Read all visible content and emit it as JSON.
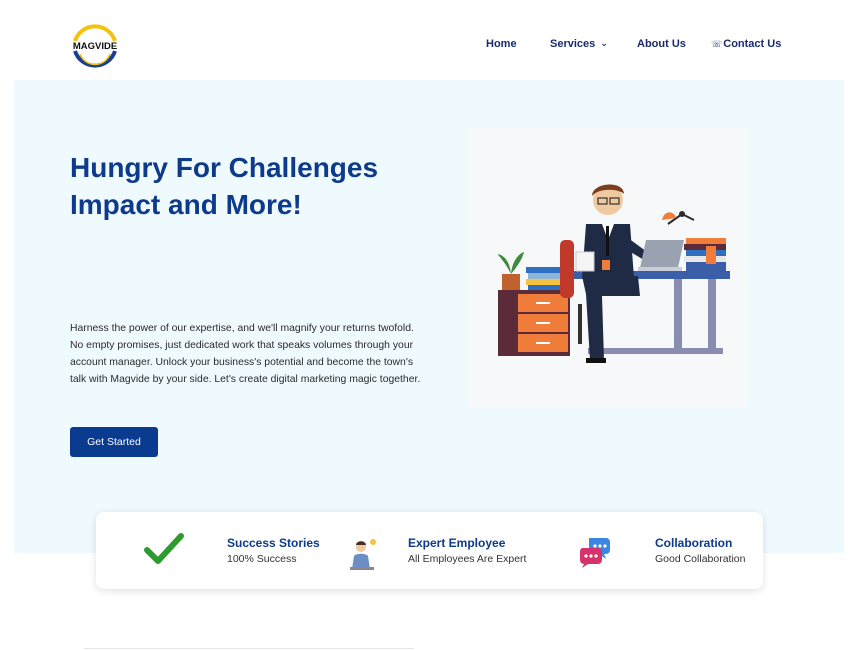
{
  "logo": {
    "text": "MAGVIDE"
  },
  "nav": {
    "home": "Home",
    "services": "Services",
    "about": "About Us",
    "contact": "Contact Us"
  },
  "hero": {
    "title_line1": "Hungry For Challenges",
    "title_line2": "Impact and More!",
    "description": "Harness the power of our expertise, and we'll magnify your returns twofold. No empty promises, just dedicated work that speaks volumes through your account manager. Unlock your business's potential and become the town's talk with Magvide by your side. Let's create digital marketing magic together.",
    "cta_label": "Get Started"
  },
  "features": [
    {
      "icon": "check-icon",
      "title": "Success Stories",
      "subtitle": "100% Success"
    },
    {
      "icon": "employee-icon",
      "title": "Expert Employee",
      "subtitle": "All Employees Are Expert"
    },
    {
      "icon": "chat-bubbles-icon",
      "title": "Collaboration",
      "subtitle": "Good Collaboration"
    }
  ],
  "colors": {
    "brand_blue": "#0d3a8a",
    "button_blue": "#0b3b8f",
    "hero_background": "#effafe",
    "accent_green": "#2e9b2e"
  }
}
